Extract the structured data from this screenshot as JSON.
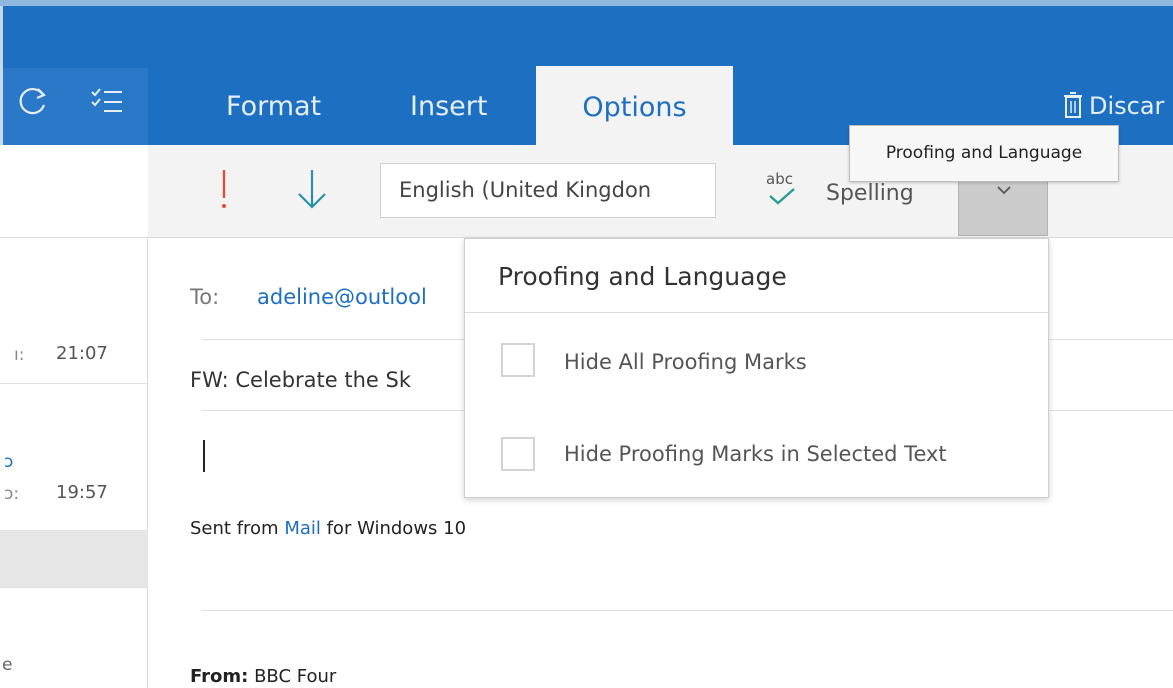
{
  "colors": {
    "accent": "#1d6fc2",
    "ribbon": "#f3f3f3",
    "tooltip_bg": "#f7f7f7"
  },
  "toolbar": {
    "sync_icon": "sync-icon",
    "filter_icon": "filter-icon"
  },
  "tabs": [
    {
      "label": "Format"
    },
    {
      "label": "Insert"
    },
    {
      "label": "Options",
      "selected": true
    }
  ],
  "actions": {
    "discard_label": "Discar",
    "discard_icon": "trash-icon"
  },
  "ribbon": {
    "importance_high_icon": "exclamation-icon",
    "importance_low_icon": "down-arrow-icon",
    "language_value": "English (United Kingdon",
    "spelling_icon": "abc-check-icon",
    "spelling_label": "Spelling",
    "dropdown_icon": "chevron-down-icon"
  },
  "tooltip": {
    "text": "Proofing and Language"
  },
  "message": {
    "to_label": "To:",
    "to_value": "adeline@outlool",
    "subject": "FW: Celebrate the Sk",
    "signature_prefix": "Sent from ",
    "signature_link": "Mail",
    "signature_suffix": " for Windows 10",
    "from_label": "From:",
    "from_value": " BBC Four"
  },
  "mail_list": {
    "item1_time": "21:07",
    "item1_frag": "ı:",
    "item2_frag_top": "ɔ",
    "item2_frag": "ɔ:",
    "item2_time": "19:57",
    "item4_frag": "e"
  },
  "proofing_menu": {
    "title": "Proofing and Language",
    "options": [
      {
        "label": "Hide All Proofing Marks",
        "checked": false
      },
      {
        "label": "Hide Proofing Marks in Selected Text",
        "checked": false
      }
    ]
  }
}
